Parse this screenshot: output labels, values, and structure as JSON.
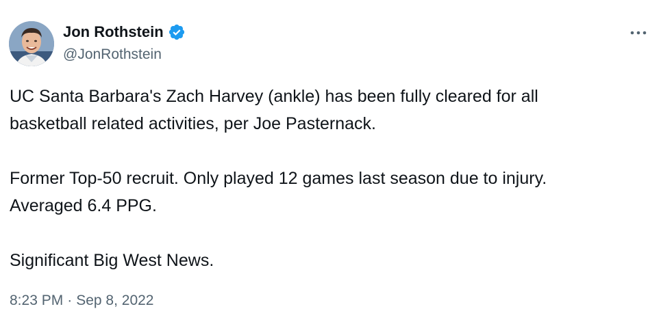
{
  "author": {
    "display_name": "Jon Rothstein",
    "handle": "@JonRothstein"
  },
  "icons": {
    "verified": "verified-badge-icon",
    "more": "more-options-icon"
  },
  "colors": {
    "verified_blue": "#1d9bf0",
    "text_primary": "#0f1419",
    "text_secondary": "#536471"
  },
  "tweet": {
    "paragraphs": [
      "UC Santa Barbara's Zach Harvey (ankle) has been fully cleared for all",
      "basketball related activities, per Joe Pasternack.",
      "Former Top-50 recruit. Only played 12 games last season due to injury.",
      "Averaged 6.4 PPG.",
      "Significant Big West News."
    ],
    "time": "8:23 PM",
    "separator": "·",
    "date": "Sep 8, 2022"
  }
}
